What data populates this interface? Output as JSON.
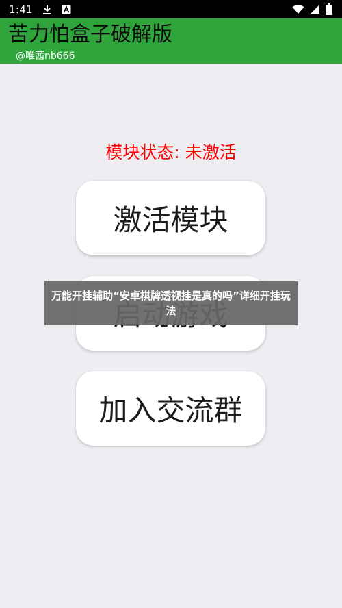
{
  "status_bar": {
    "time": "1:41",
    "icons": [
      "download-icon",
      "notification-a-icon",
      "wifi-icon",
      "signal-icon",
      "battery-icon"
    ]
  },
  "app_bar": {
    "title": "苦力怕盒子破解版",
    "subtitle": "@唯茜nb666",
    "color": "#2ea43a"
  },
  "module_status": {
    "text": "模块状态: 未激活",
    "color": "#ff0000"
  },
  "buttons": {
    "activate": "激活模块",
    "launch": "启动游戏",
    "join_group": "加入交流群"
  },
  "overlay": {
    "text": "万能开挂辅助“安卓棋牌透视挂是真的吗”详细开挂玩法"
  },
  "colors": {
    "background": "#eeedf2",
    "status_bar": "#000000"
  }
}
